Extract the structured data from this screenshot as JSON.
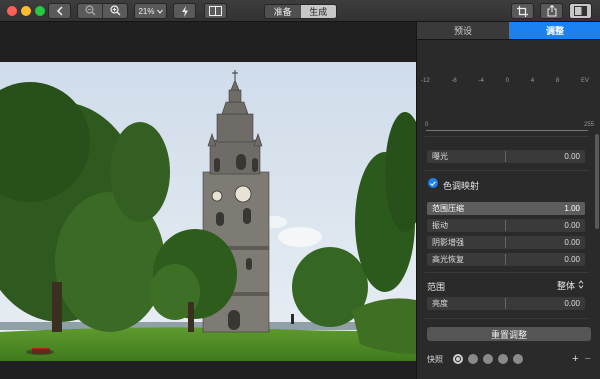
{
  "toolbar": {
    "zoom_value": "21%",
    "segments": [
      "准备",
      "生成"
    ],
    "active_segment": 1
  },
  "icons": {
    "back": "chevron-left-icon",
    "zoom_out": "zoom-out-icon",
    "zoom_in": "zoom-in-icon",
    "auto": "lightning-icon",
    "compare": "split-view-icon",
    "crop": "crop-icon",
    "share": "share-icon",
    "sidebar": "sidebar-icon"
  },
  "panel": {
    "tabs": [
      "预设",
      "调整"
    ],
    "active_tab": 1,
    "histogram": {
      "ev_ticks": [
        "-12",
        "-8",
        "-4",
        "0",
        "4",
        "8",
        "EV"
      ],
      "range_min": "0",
      "range_max": "255"
    },
    "exposure": {
      "label": "曝光",
      "value": "0.00"
    },
    "tonemap": {
      "title": "色调映射",
      "rows": [
        {
          "label": "范围压缩",
          "value": "1.00"
        },
        {
          "label": "振动",
          "value": "0.00"
        },
        {
          "label": "阴影增强",
          "value": "0.00"
        },
        {
          "label": "高光恢复",
          "value": "0.00"
        }
      ]
    },
    "range": {
      "title": "范围",
      "mode": "整体"
    },
    "brightness": {
      "label": "亮度",
      "value": "0.00"
    },
    "reset_label": "重置调整",
    "snapshots_label": "快照",
    "snapshot_add": "+",
    "snapshot_remove": "−"
  },
  "colors": {
    "accent": "#1b80f0",
    "close": "#ff5f57",
    "minimize": "#febc2e",
    "maximize": "#28c840"
  }
}
